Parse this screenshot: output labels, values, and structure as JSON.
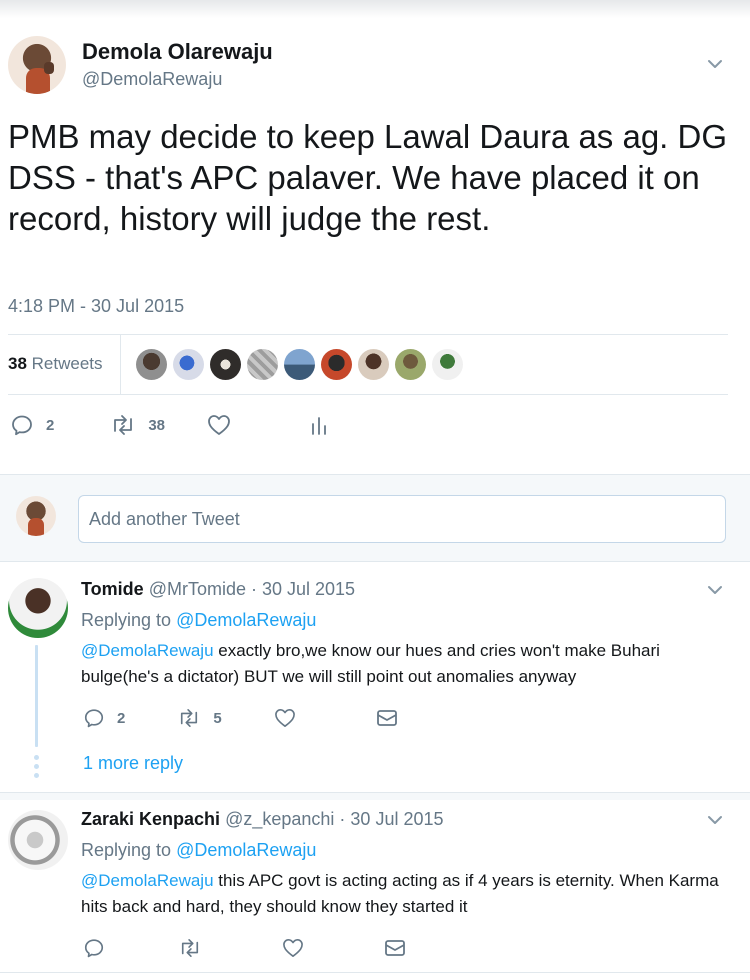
{
  "main_tweet": {
    "author_name": "Demola Olarewaju",
    "author_handle": "@DemolaRewaju",
    "text": "PMB may decide to keep Lawal Daura as ag. DG DSS - that's APC palaver. We have placed it on record, history will judge the rest.",
    "timestamp": "4:18 PM - 30 Jul 2015",
    "retweets_count": "38",
    "retweets_label": " Retweets",
    "reply_count": "2",
    "retweet_count": "38"
  },
  "compose": {
    "placeholder": "Add another Tweet"
  },
  "replies": [
    {
      "name": "Tomide",
      "handle": "@MrTomide",
      "date": " · 30 Jul 2015",
      "replying_prefix": "Replying to ",
      "replying_to": "@DemolaRewaju",
      "mention": "@DemolaRewaju",
      "text": " exactly bro,we know our hues and cries won't make Buhari bulge(he's a dictator) BUT we will still point out anomalies anyway",
      "reply_count": "2",
      "retweet_count": "5",
      "more_replies": "1 more reply"
    },
    {
      "name": "Zaraki Kenpachi",
      "handle": "@z_kepanchi",
      "date": " · 30 Jul 2015",
      "replying_prefix": "Replying to ",
      "replying_to": "@DemolaRewaju",
      "mention": "@DemolaRewaju",
      "text": " this APC govt is acting acting as if 4 years is eternity. When Karma hits back and hard, they should know they started it"
    }
  ],
  "colors": {
    "link": "#1da1f2",
    "muted": "#657786",
    "text": "#14171a"
  },
  "icons": [
    "chevron-down-icon",
    "reply-icon",
    "retweet-icon",
    "like-icon",
    "analytics-icon",
    "direct-message-icon"
  ]
}
